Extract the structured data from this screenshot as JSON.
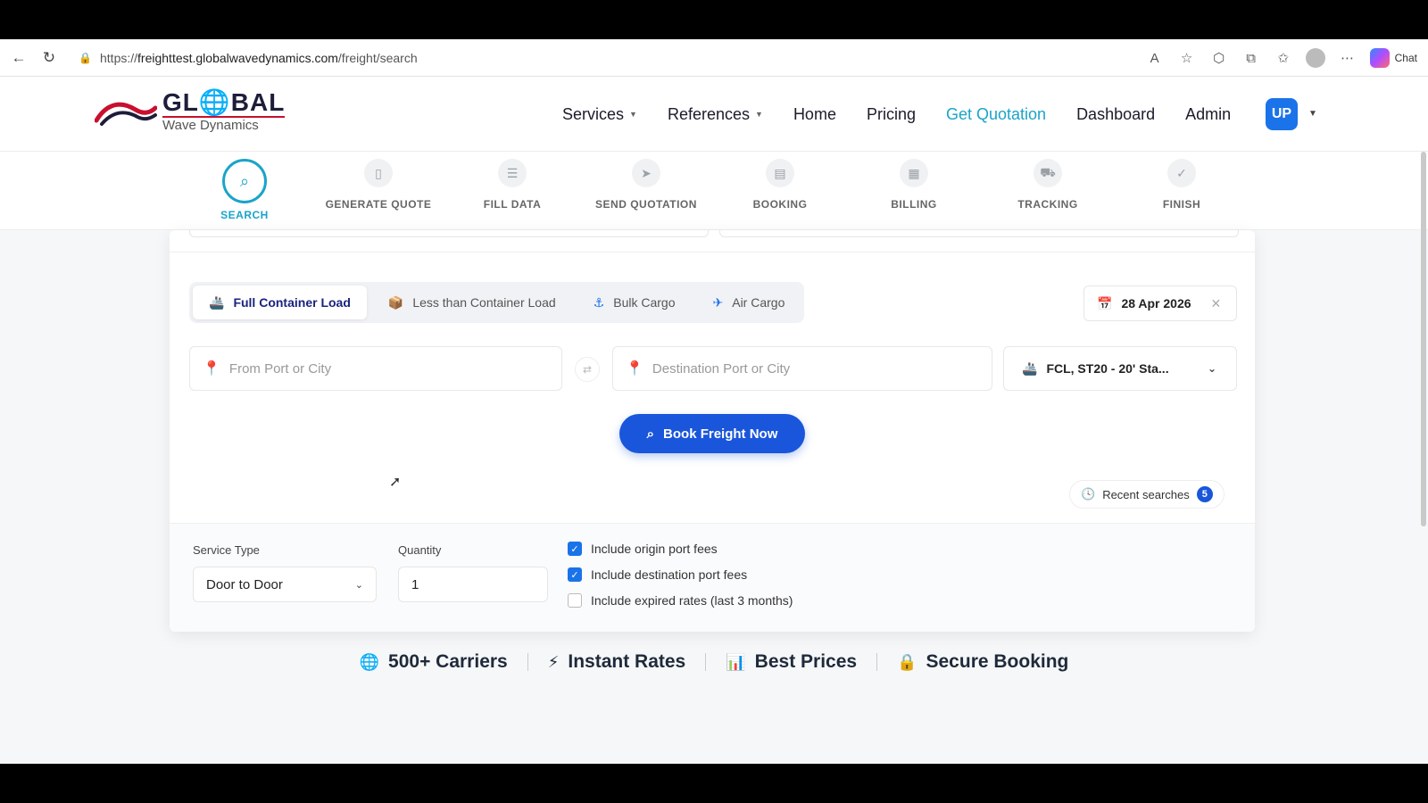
{
  "browser": {
    "url_prefix": "https://",
    "url_host": "freighttest.globalwavedynamics.com",
    "url_path": "/freight/search",
    "copilot_label": "Chat"
  },
  "brand": {
    "name": "GL🌐BAL",
    "tagline": "Wave Dynamics"
  },
  "nav": {
    "services": "Services",
    "references": "References",
    "home": "Home",
    "pricing": "Pricing",
    "get_quotation": "Get Quotation",
    "dashboard": "Dashboard",
    "admin": "Admin",
    "user_initials": "UP"
  },
  "steps": [
    {
      "label": "SEARCH",
      "icon": "search-icon"
    },
    {
      "label": "GENERATE QUOTE",
      "icon": "document-icon"
    },
    {
      "label": "FILL DATA",
      "icon": "form-icon"
    },
    {
      "label": "SEND QUOTATION",
      "icon": "send-icon"
    },
    {
      "label": "BOOKING",
      "icon": "booking-icon"
    },
    {
      "label": "BILLING",
      "icon": "billing-icon"
    },
    {
      "label": "TRACKING",
      "icon": "truck-icon"
    },
    {
      "label": "FINISH",
      "icon": "check-circle-icon"
    }
  ],
  "modes": {
    "fcl": "Full Container Load",
    "lcl": "Less than Container Load",
    "bulk": "Bulk Cargo",
    "air": "Air Cargo"
  },
  "date": "28 Apr 2026",
  "search": {
    "origin_placeholder": "From Port or City",
    "destination_placeholder": "Destination Port or City",
    "container": "FCL, ST20 - 20' Sta...",
    "book_label": "Book Freight Now",
    "recent_label": "Recent searches",
    "recent_count": "5"
  },
  "options": {
    "service_type_label": "Service Type",
    "service_type_value": "Door to Door",
    "quantity_label": "Quantity",
    "quantity_value": "1",
    "origin_fees": "Include origin port fees",
    "destination_fees": "Include destination port fees",
    "expired_rates": "Include expired rates (last 3 months)"
  },
  "features": {
    "carriers": "500+ Carriers",
    "instant": "Instant Rates",
    "prices": "Best Prices",
    "secure": "Secure Booking"
  },
  "colors": {
    "accent": "#1aa4c8",
    "primary": "#1a56db",
    "brand_red": "#c8102e"
  }
}
